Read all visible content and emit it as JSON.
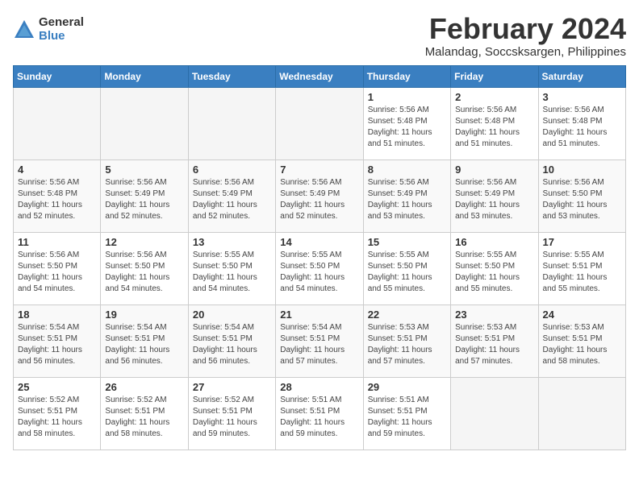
{
  "logo": {
    "general": "General",
    "blue": "Blue"
  },
  "title": "February 2024",
  "location": "Malandag, Soccsksargen, Philippines",
  "days_of_week": [
    "Sunday",
    "Monday",
    "Tuesday",
    "Wednesday",
    "Thursday",
    "Friday",
    "Saturday"
  ],
  "weeks": [
    [
      {
        "day": "",
        "info": ""
      },
      {
        "day": "",
        "info": ""
      },
      {
        "day": "",
        "info": ""
      },
      {
        "day": "",
        "info": ""
      },
      {
        "day": "1",
        "info": "Sunrise: 5:56 AM\nSunset: 5:48 PM\nDaylight: 11 hours and 51 minutes."
      },
      {
        "day": "2",
        "info": "Sunrise: 5:56 AM\nSunset: 5:48 PM\nDaylight: 11 hours and 51 minutes."
      },
      {
        "day": "3",
        "info": "Sunrise: 5:56 AM\nSunset: 5:48 PM\nDaylight: 11 hours and 51 minutes."
      }
    ],
    [
      {
        "day": "4",
        "info": "Sunrise: 5:56 AM\nSunset: 5:48 PM\nDaylight: 11 hours and 52 minutes."
      },
      {
        "day": "5",
        "info": "Sunrise: 5:56 AM\nSunset: 5:49 PM\nDaylight: 11 hours and 52 minutes."
      },
      {
        "day": "6",
        "info": "Sunrise: 5:56 AM\nSunset: 5:49 PM\nDaylight: 11 hours and 52 minutes."
      },
      {
        "day": "7",
        "info": "Sunrise: 5:56 AM\nSunset: 5:49 PM\nDaylight: 11 hours and 52 minutes."
      },
      {
        "day": "8",
        "info": "Sunrise: 5:56 AM\nSunset: 5:49 PM\nDaylight: 11 hours and 53 minutes."
      },
      {
        "day": "9",
        "info": "Sunrise: 5:56 AM\nSunset: 5:49 PM\nDaylight: 11 hours and 53 minutes."
      },
      {
        "day": "10",
        "info": "Sunrise: 5:56 AM\nSunset: 5:50 PM\nDaylight: 11 hours and 53 minutes."
      }
    ],
    [
      {
        "day": "11",
        "info": "Sunrise: 5:56 AM\nSunset: 5:50 PM\nDaylight: 11 hours and 54 minutes."
      },
      {
        "day": "12",
        "info": "Sunrise: 5:56 AM\nSunset: 5:50 PM\nDaylight: 11 hours and 54 minutes."
      },
      {
        "day": "13",
        "info": "Sunrise: 5:55 AM\nSunset: 5:50 PM\nDaylight: 11 hours and 54 minutes."
      },
      {
        "day": "14",
        "info": "Sunrise: 5:55 AM\nSunset: 5:50 PM\nDaylight: 11 hours and 54 minutes."
      },
      {
        "day": "15",
        "info": "Sunrise: 5:55 AM\nSunset: 5:50 PM\nDaylight: 11 hours and 55 minutes."
      },
      {
        "day": "16",
        "info": "Sunrise: 5:55 AM\nSunset: 5:50 PM\nDaylight: 11 hours and 55 minutes."
      },
      {
        "day": "17",
        "info": "Sunrise: 5:55 AM\nSunset: 5:51 PM\nDaylight: 11 hours and 55 minutes."
      }
    ],
    [
      {
        "day": "18",
        "info": "Sunrise: 5:54 AM\nSunset: 5:51 PM\nDaylight: 11 hours and 56 minutes."
      },
      {
        "day": "19",
        "info": "Sunrise: 5:54 AM\nSunset: 5:51 PM\nDaylight: 11 hours and 56 minutes."
      },
      {
        "day": "20",
        "info": "Sunrise: 5:54 AM\nSunset: 5:51 PM\nDaylight: 11 hours and 56 minutes."
      },
      {
        "day": "21",
        "info": "Sunrise: 5:54 AM\nSunset: 5:51 PM\nDaylight: 11 hours and 57 minutes."
      },
      {
        "day": "22",
        "info": "Sunrise: 5:53 AM\nSunset: 5:51 PM\nDaylight: 11 hours and 57 minutes."
      },
      {
        "day": "23",
        "info": "Sunrise: 5:53 AM\nSunset: 5:51 PM\nDaylight: 11 hours and 57 minutes."
      },
      {
        "day": "24",
        "info": "Sunrise: 5:53 AM\nSunset: 5:51 PM\nDaylight: 11 hours and 58 minutes."
      }
    ],
    [
      {
        "day": "25",
        "info": "Sunrise: 5:52 AM\nSunset: 5:51 PM\nDaylight: 11 hours and 58 minutes."
      },
      {
        "day": "26",
        "info": "Sunrise: 5:52 AM\nSunset: 5:51 PM\nDaylight: 11 hours and 58 minutes."
      },
      {
        "day": "27",
        "info": "Sunrise: 5:52 AM\nSunset: 5:51 PM\nDaylight: 11 hours and 59 minutes."
      },
      {
        "day": "28",
        "info": "Sunrise: 5:51 AM\nSunset: 5:51 PM\nDaylight: 11 hours and 59 minutes."
      },
      {
        "day": "29",
        "info": "Sunrise: 5:51 AM\nSunset: 5:51 PM\nDaylight: 11 hours and 59 minutes."
      },
      {
        "day": "",
        "info": ""
      },
      {
        "day": "",
        "info": ""
      }
    ]
  ]
}
